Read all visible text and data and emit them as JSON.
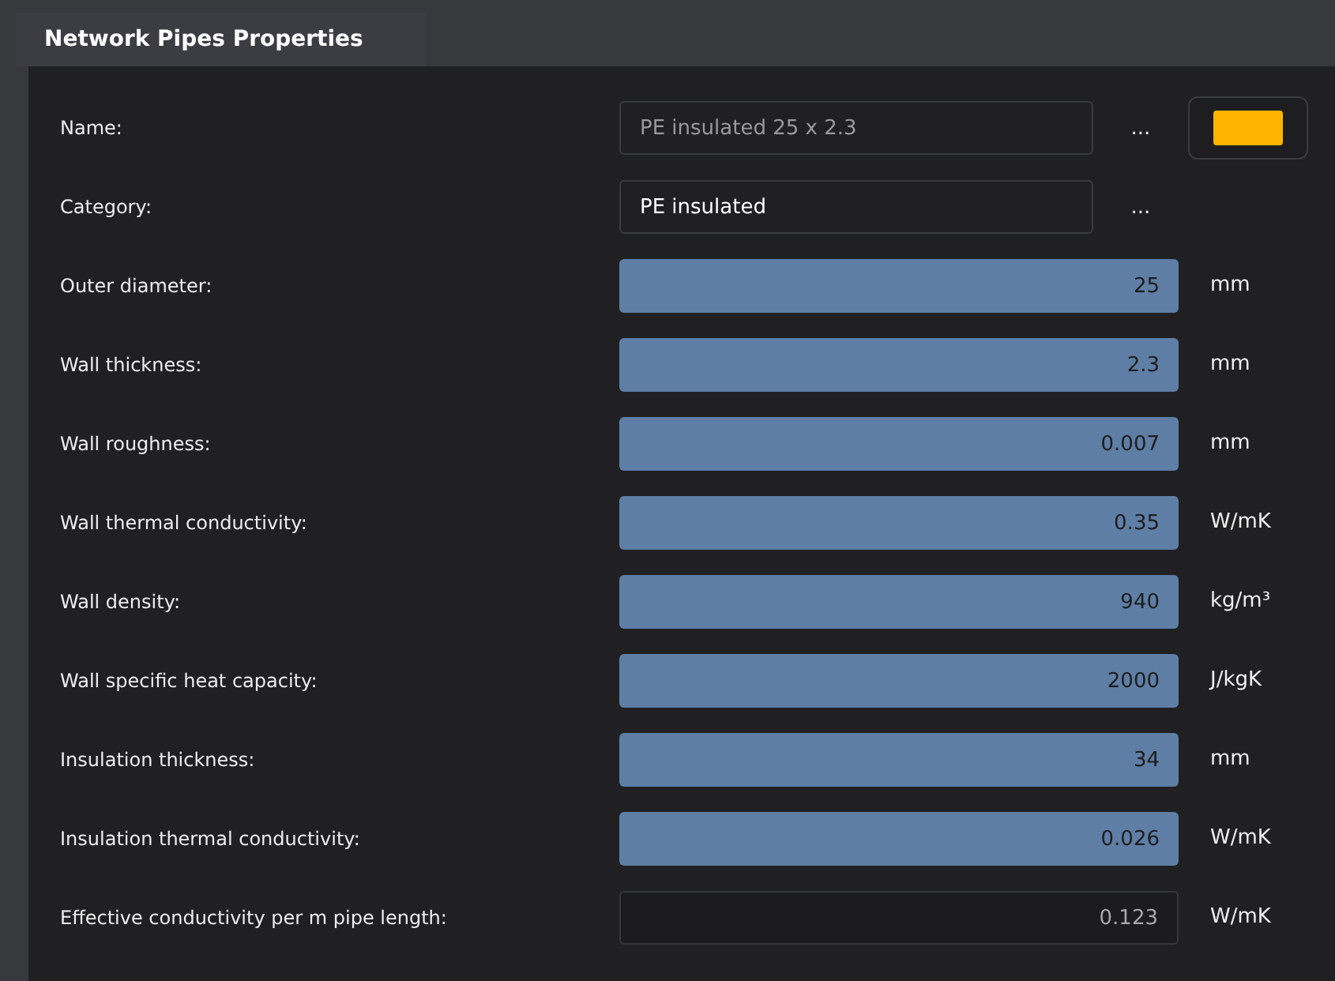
{
  "panel": {
    "title": "Network Pipes Properties"
  },
  "rows": [
    {
      "kind": "text",
      "label": "Name:",
      "value": "PE insulated 25 x 2.3",
      "disabled": true,
      "browse": "...",
      "color": "#ffb400"
    },
    {
      "kind": "text",
      "label": "Category:",
      "value": "PE insulated",
      "disabled": false,
      "browse": "..."
    },
    {
      "kind": "number",
      "label": "Outer diameter:",
      "value": "25",
      "unit": "mm"
    },
    {
      "kind": "number",
      "label": "Wall thickness:",
      "value": "2.3",
      "unit": "mm"
    },
    {
      "kind": "number",
      "label": "Wall roughness:",
      "value": "0.007",
      "unit": "mm"
    },
    {
      "kind": "number",
      "label": "Wall thermal conductivity:",
      "value": "0.35",
      "unit": "W/mK"
    },
    {
      "kind": "number",
      "label": "Wall density:",
      "value": "940",
      "unit": "kg/m³"
    },
    {
      "kind": "number",
      "label": "Wall specific heat capacity:",
      "value": "2000",
      "unit": "J/kgK"
    },
    {
      "kind": "number",
      "label": "Insulation thickness:",
      "value": "34",
      "unit": "mm"
    },
    {
      "kind": "number",
      "label": "Insulation thermal conductivity:",
      "value": "0.026",
      "unit": "W/mK"
    },
    {
      "kind": "computed",
      "label": "Effective conductivity per m pipe length:",
      "value": "0.123",
      "unit": "W/mK"
    }
  ]
}
